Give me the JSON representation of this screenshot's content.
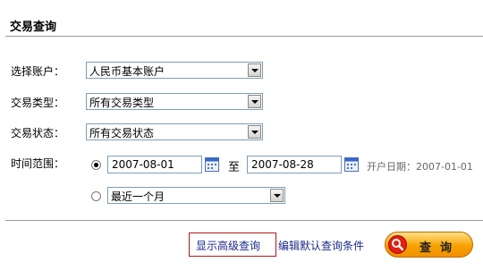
{
  "header": {
    "title": "交易查询"
  },
  "form": {
    "account": {
      "label": "选择账户：",
      "value": "人民币基本账户"
    },
    "type": {
      "label": "交易类型：",
      "value": "所有交易类型"
    },
    "status": {
      "label": "交易状态：",
      "value": "所有交易状态"
    },
    "range": {
      "label": "时间范围：",
      "start_date": "2007-08-01",
      "to_label": "至",
      "end_date": "2007-08-28",
      "open_date_hint": "开户日期：2007-01-01",
      "preset_value": "最近一个月",
      "selected_option": "custom"
    }
  },
  "actions": {
    "advanced_label": "显示高级查询",
    "edit_default_label": "编辑默认查询条件",
    "query_label": "查询"
  },
  "colors": {
    "link": "#1a2a8a",
    "button": "#f7a300",
    "highlight_border": "#b01818"
  }
}
